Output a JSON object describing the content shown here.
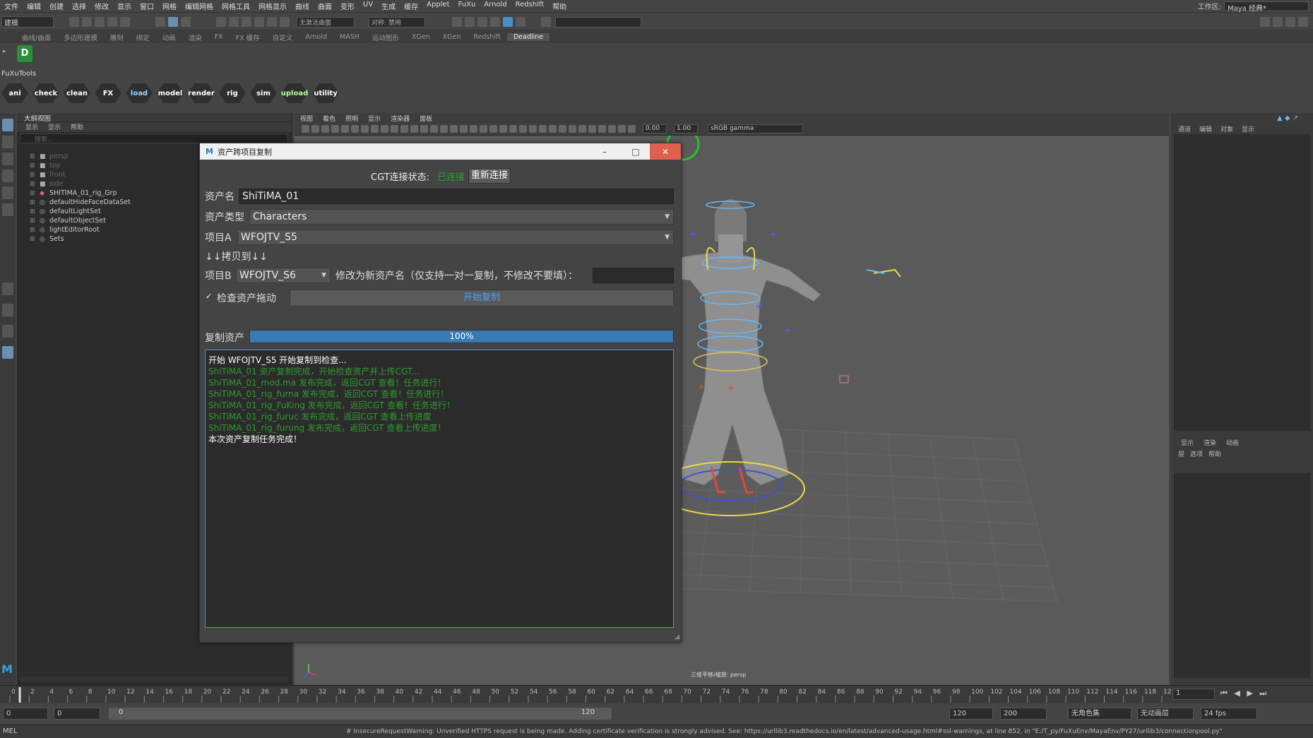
{
  "menubar": {
    "items": [
      "文件",
      "编辑",
      "创建",
      "选择",
      "修改",
      "显示",
      "窗口",
      "网格",
      "编辑网格",
      "网格工具",
      "网格显示",
      "曲线",
      "曲面",
      "变形",
      "UV",
      "生成",
      "缓存",
      "Applet",
      "FuXu",
      "Arnold",
      "Redshift",
      "帮助"
    ],
    "workspace_label": "工作区:",
    "workspace_value": "Maya 经典*"
  },
  "statusline": {
    "mode": "建模",
    "live_field": "无激活曲面",
    "symmetry": "对称: 禁用"
  },
  "shelf": {
    "tabs": [
      "曲线/曲面",
      "多边形建模",
      "雕刻",
      "绑定",
      "动画",
      "渲染",
      "FX",
      "FX 缓存",
      "自定义",
      "Arnold",
      "MASH",
      "运动图形",
      "XGen",
      "XGen",
      "Redshift",
      "Deadline"
    ],
    "active_tab": "Deadline"
  },
  "fuxutools": {
    "label": "FuXuTools",
    "buttons": [
      {
        "label": "ani",
        "color": "#ffffff"
      },
      {
        "label": "check",
        "color": "#ffffff"
      },
      {
        "label": "clean",
        "color": "#ffffff"
      },
      {
        "label": "FX",
        "color": "#ffffff"
      },
      {
        "label": "load",
        "color": "#9ad0ff"
      },
      {
        "label": "model",
        "color": "#ffffff"
      },
      {
        "label": "render",
        "color": "#ffffff"
      },
      {
        "label": "rig",
        "color": "#ffffff"
      },
      {
        "label": "sim",
        "color": "#ffffff"
      },
      {
        "label": "upload",
        "color": "#b7ff9a"
      },
      {
        "label": "utility",
        "color": "#ffffff"
      }
    ]
  },
  "outliner": {
    "title": "大纲视图",
    "menu": [
      "显示",
      "显示",
      "帮助"
    ],
    "search_placeholder": "搜索...",
    "items": [
      {
        "label": "persp",
        "icon": "camera-icon",
        "dim": true
      },
      {
        "label": "top",
        "icon": "camera-icon",
        "dim": true
      },
      {
        "label": "front",
        "icon": "camera-icon",
        "dim": true
      },
      {
        "label": "side",
        "icon": "camera-icon",
        "dim": true
      },
      {
        "label": "SHITIMA_01_rig_Grp",
        "icon": "group-icon",
        "dim": false
      },
      {
        "label": "defaultHideFaceDataSet",
        "icon": "set-icon",
        "dim": false
      },
      {
        "label": "defaultLightSet",
        "icon": "set-icon",
        "dim": false
      },
      {
        "label": "defaultObjectSet",
        "icon": "set-icon",
        "dim": false
      },
      {
        "label": "lightEditorRoot",
        "icon": "set-icon",
        "dim": false
      },
      {
        "label": "Sets",
        "icon": "set-icon",
        "dim": false
      }
    ]
  },
  "viewport": {
    "menu": [
      "视图",
      "着色",
      "照明",
      "显示",
      "渲染器",
      "面板"
    ],
    "exposure": "0.00",
    "gamma": "1.00",
    "colorspace": "sRGB gamma",
    "camera_label": "三维平移/缩放: persp"
  },
  "channelbox": {
    "top_tabs": [
      "通道",
      "编辑",
      "对象",
      "显示"
    ],
    "mid_tabs": [
      "显示",
      "渲染",
      "动画"
    ],
    "mid_menu": [
      "层",
      "选项",
      "帮助"
    ]
  },
  "timeline": {
    "ticks": [
      "0",
      "2",
      "4",
      "6",
      "8",
      "10",
      "12",
      "14",
      "16",
      "18",
      "20",
      "22",
      "24",
      "26",
      "28",
      "30",
      "32",
      "34",
      "36",
      "38",
      "40",
      "42",
      "44",
      "46",
      "48",
      "50",
      "52",
      "54",
      "56",
      "58",
      "60",
      "62",
      "64",
      "66",
      "68",
      "70",
      "72",
      "74",
      "76",
      "78",
      "80",
      "82",
      "84",
      "86",
      "88",
      "90",
      "92",
      "94",
      "96",
      "98",
      "100",
      "102",
      "104",
      "106",
      "108",
      "110",
      "112",
      "114",
      "116",
      "118",
      "120"
    ],
    "current_frame": "1"
  },
  "range": {
    "start": "0",
    "anim_start": "0",
    "slider_start": "0",
    "slider_end": "120",
    "anim_end": "120",
    "end": "200",
    "char_set": "无角色集",
    "anim_layer": "无动画层",
    "fps": "24 fps"
  },
  "cmdline": {
    "mel": "MEL",
    "message": "# InsecureRequestWarning: Unverified HTTPS request is being made. Adding certificate verification is strongly advised. See: https://urllib3.readthedocs.io/en/latest/advanced-usage.html#ssl-warnings, at line 852, in \"E:/T_py/FuXuEnv/MayaEnv/PY27/urllib3/connectionpool.py\""
  },
  "dialog": {
    "title": "资产跨项目复制",
    "cgt_label": "CGT连接状态:",
    "cgt_status": "已连接",
    "reconnect": "重新连接",
    "asset_name_label": "资产名",
    "asset_name": "ShiTiMA_01",
    "asset_type_label": "资产类型",
    "asset_type": "Characters",
    "project_a_label": "项目A",
    "project_a": "WFOJTV_S5",
    "copy_to_label": "↓↓拷贝到↓↓",
    "project_b_label": "项目B",
    "project_b": "WFOJTV_S6",
    "rename_label": "修改为新资产名（仅支持一对一复制，不修改不要填）：",
    "rename_value": "",
    "check_label": "检查资产拖动",
    "check_checked": true,
    "start_button": "开始复制",
    "progress_label": "复制资产",
    "progress_value": 1.0,
    "progress_text": "100%",
    "log": [
      {
        "text": "开始 WFOJTV_S5 开始复制到检查...",
        "color": "w"
      },
      {
        "text": "ShiTiMA_01 资产复制完成，开始检查资产并上传CGT...",
        "color": "g"
      },
      {
        "text": "ShiTiMA_01_mod.ma 发布完成，返回CGT 查看！任务进行！",
        "color": "g"
      },
      {
        "text": "ShiTiMA_01_rig_furna 发布完成，返回CGT 查看！任务进行！",
        "color": "g"
      },
      {
        "text": "ShiTiMA_01_rig_FuKing 发布完成，返回CGT 查看！任务进行！",
        "color": "g"
      },
      {
        "text": "ShiTiMA_01_rig_furuc 发布完成，返回CGT 查看上传进度",
        "color": "g"
      },
      {
        "text": "ShiTiMA_01_rig_furung 发布完成，返回CGT 查看上传进度！",
        "color": "g"
      },
      {
        "text": "本次资产复制任务完成！",
        "color": "w"
      }
    ]
  }
}
